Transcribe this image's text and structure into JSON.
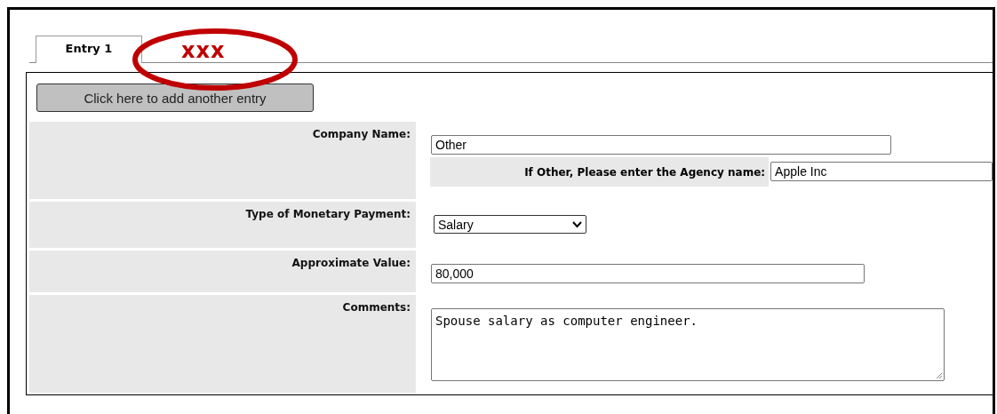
{
  "tabs": [
    {
      "label": "Entry 1",
      "selected": true
    }
  ],
  "annotation": {
    "text": "xxx"
  },
  "add_entry_button": "Click here to add another entry",
  "form": {
    "rows": [
      {
        "kind": "text",
        "label": "Company Name:",
        "value": "Other",
        "sub_field": {
          "label": "If Other, Please enter the Agency name:",
          "value": "Apple Inc"
        }
      },
      {
        "kind": "select",
        "label": "Type of Monetary Payment:",
        "value": "Salary"
      },
      {
        "kind": "text",
        "label": "Approximate Value:",
        "value": "80,000"
      },
      {
        "kind": "textarea",
        "label": "Comments:",
        "value": "Spouse salary as computer engineer."
      }
    ]
  }
}
